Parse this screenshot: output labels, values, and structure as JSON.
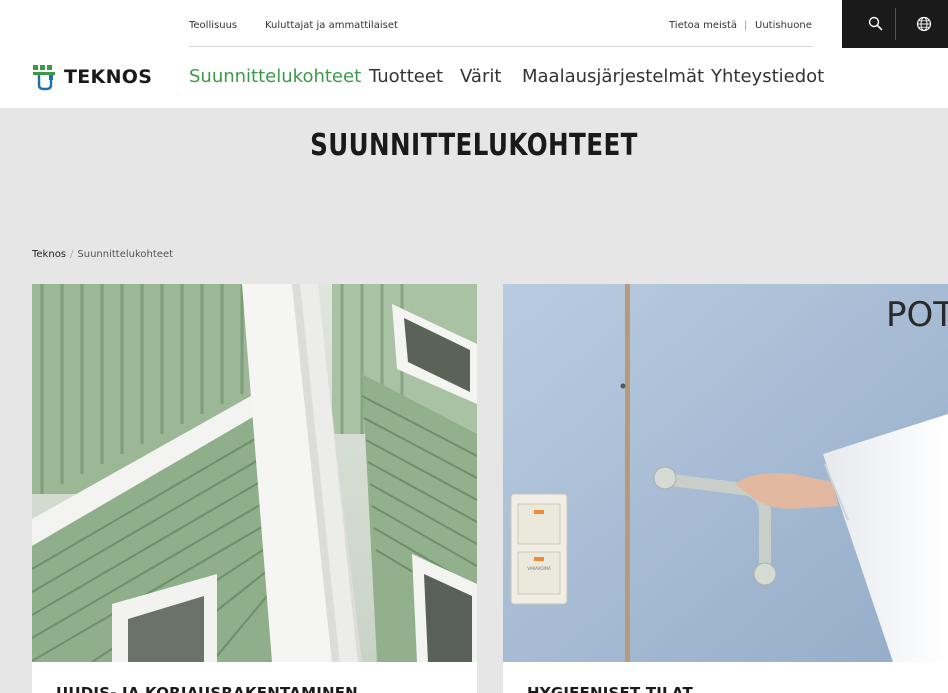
{
  "header": {
    "utility_left": [
      "Teollisuus",
      "Kuluttajat ja ammattilaiset"
    ],
    "utility_right": [
      "Tietoa meistä",
      "Uutishuone"
    ],
    "utility_separator": "|",
    "icons": [
      "search-icon",
      "globe-icon"
    ]
  },
  "logo": {
    "text": "TEKNOS",
    "color": "#3a9a48"
  },
  "nav": {
    "items": [
      "Suunnittelukohteet",
      "Tuotteet",
      "Värit",
      "Maalausjärjestelmät",
      "Yhteystiedot"
    ],
    "active_color": "#3a9a48"
  },
  "hero": {
    "title": "SUUNNITTELUKOHTEET"
  },
  "breadcrumb": {
    "home": "Teknos",
    "separator": "/",
    "current": "Suunnittelukohteet"
  },
  "cards": [
    {
      "title": "UUDIS- JA KORJAUSRAKENTAMINEN",
      "image_text": ""
    },
    {
      "title": "HYGIEENISET TILAT",
      "image_text": "POT",
      "switch_label": "VARAVOIMA"
    }
  ]
}
